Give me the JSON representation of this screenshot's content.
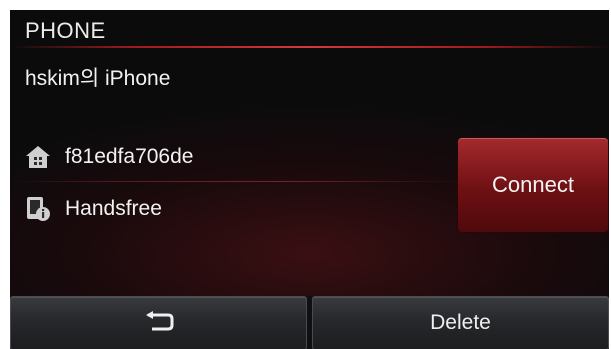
{
  "header": {
    "title": "PHONE"
  },
  "device": {
    "name": "hskim의 iPhone",
    "address": "f81edfa706de",
    "profile": "Handsfree"
  },
  "actions": {
    "connect_label": "Connect",
    "delete_label": "Delete"
  },
  "icons": {
    "address": "home-icon",
    "profile": "handsfree-info-icon",
    "back": "back-arrow-icon"
  },
  "colors": {
    "accent": "#9d1a1c",
    "text": "#f2f2f2",
    "background": "#0b0b0c"
  }
}
